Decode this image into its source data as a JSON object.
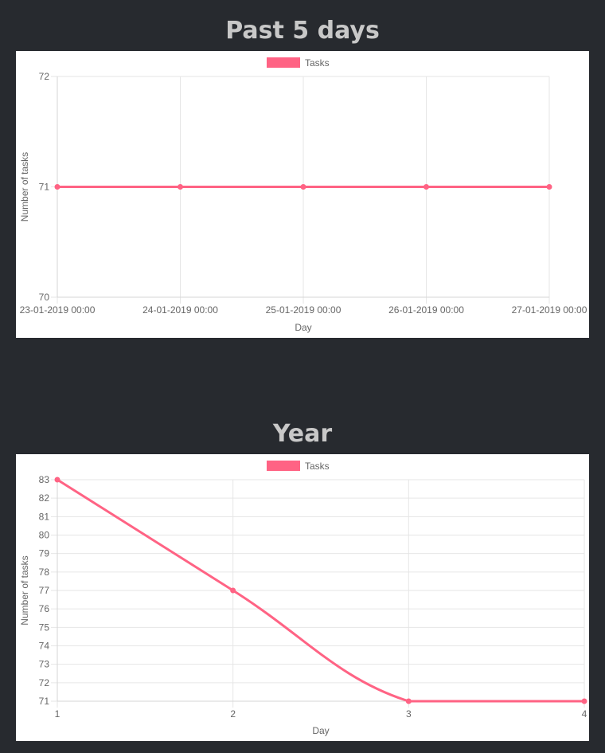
{
  "theme": {
    "background": "#272a2f",
    "title_color": "#c8c8c8",
    "series_color": "#ff6384",
    "grid_color": "#e6e6e6"
  },
  "sections": [
    {
      "title": "Past 5 days"
    },
    {
      "title": "Year"
    }
  ],
  "chart_data": [
    {
      "type": "line",
      "title": "Past 5 days",
      "xlabel": "Day",
      "ylabel": "Number of tasks",
      "categories": [
        "23-01-2019 00:00",
        "24-01-2019 00:00",
        "25-01-2019 00:00",
        "26-01-2019 00:00",
        "27-01-2019 00:00"
      ],
      "series": [
        {
          "name": "Tasks",
          "values": [
            71,
            71,
            71,
            71,
            71
          ]
        }
      ],
      "ylim": [
        70,
        72
      ],
      "yticks": [
        70,
        71,
        72
      ],
      "grid": true,
      "legend": "top-center"
    },
    {
      "type": "line",
      "title": "Year",
      "xlabel": "Day",
      "ylabel": "Number of tasks",
      "categories": [
        "1",
        "2",
        "3",
        "4"
      ],
      "series": [
        {
          "name": "Tasks",
          "values": [
            83,
            77,
            71,
            71
          ]
        }
      ],
      "ylim": [
        71,
        83
      ],
      "yticks": [
        71,
        72,
        73,
        74,
        75,
        76,
        77,
        78,
        79,
        80,
        81,
        82,
        83
      ],
      "grid": true,
      "legend": "top-center"
    }
  ]
}
